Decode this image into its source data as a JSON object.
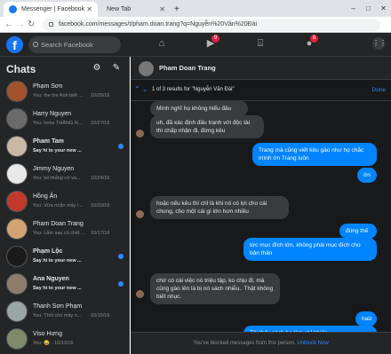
{
  "browser": {
    "tabs": [
      {
        "title": "Messenger | Facebook",
        "active": true
      },
      {
        "title": "New Tab",
        "active": false
      }
    ],
    "new_tab": "+",
    "url": "facebook.com/messages/t/pham.doan.trang?q=Nguyễn%20Văn%20Đài",
    "controls": {
      "minimize": "–",
      "maximize": "□",
      "close": "✕"
    }
  },
  "fb": {
    "logo": "f",
    "search_placeholder": "Search Facebook",
    "nav": [
      {
        "icon": "home-icon",
        "glyph": "⌂",
        "badge": ""
      },
      {
        "icon": "watch-icon",
        "glyph": "▶",
        "badge": "9"
      },
      {
        "icon": "marketplace-icon",
        "glyph": "⌸",
        "badge": ""
      },
      {
        "icon": "groups-icon",
        "glyph": "●",
        "badge": "6"
      }
    ],
    "menu_icon": "⋮⋮"
  },
  "sidebar": {
    "title": "Chats",
    "chats": [
      {
        "name": "Phạm Sơn",
        "preview": "You: ihe ihe  Anh biết ...",
        "time": "10/28/16",
        "unread": false,
        "color": "#a0522d"
      },
      {
        "name": "Harry Nguyen",
        "preview": "You: hehe THĂNG N...",
        "time": "10/27/16",
        "unread": false,
        "color": "#6b6b6b"
      },
      {
        "name": "Pham Tam",
        "preview": "Say hi to your new ...",
        "time": "",
        "unread": true,
        "color": "#c9b8a6"
      },
      {
        "name": "Jimmy Nguyen",
        "preview": "You: bỏ thắng cờ va...",
        "time": "10/24/16",
        "unread": false,
        "color": "#e8e8e8"
      },
      {
        "name": "Hồng Ân",
        "preview": "You: Vừa nhắn mấy l...",
        "time": "10/20/16",
        "unread": false,
        "color": "#c0392b"
      },
      {
        "name": "Pham Doan Trang",
        "preview": "You: Lắm sau có chết ...",
        "time": "10/17/16",
        "unread": false,
        "color": "#d4a373"
      },
      {
        "name": "Phạm Lộc",
        "preview": "Say hi to your new ...",
        "time": "",
        "unread": true,
        "color": "#1b1b1b"
      },
      {
        "name": "Ana Nguyen",
        "preview": "Say hi to your new ...",
        "time": "",
        "unread": true,
        "color": "#8e7d6b"
      },
      {
        "name": "Thanh Sơn Phạm",
        "preview": "You: Thôi cho máy n...",
        "time": "10/15/16",
        "unread": false,
        "color": "#9aa5a6"
      },
      {
        "name": "Viso Hưng",
        "preview": "You: 😂 · 10/13/16",
        "time": "",
        "unread": false,
        "color": "#7d8b6a"
      }
    ]
  },
  "conversation": {
    "name": "Pham Doan Trang",
    "find": {
      "result": "1 of 3 results for \"Nguyễn Văn Đài\"",
      "done": "Done",
      "arrows": "⌃⌄"
    },
    "messages": [
      {
        "dir": "in",
        "text": "Mình nghĩ họ không hiểu đâu"
      },
      {
        "dir": "in",
        "text": "uh, đã xác định đấu tranh với độc tài thì chấp nhận đi, đừng kêu"
      },
      {
        "dir": "out",
        "text": "Trang mà cũng viết kêu gào như họ chắc mình ớn Trang luôn"
      },
      {
        "dir": "out",
        "text": "ớn"
      },
      {
        "dir": "in",
        "text": "hoặc nếu kêu thì chỉ là khi nó có lợi cho cái chung, cho một cái gì lớn hơn nhiều"
      },
      {
        "dir": "out",
        "text": "đúng thế"
      },
      {
        "dir": "out",
        "text": "tức mục đích lớn, không phải mục đích cho bản thân"
      },
      {
        "dir": "in",
        "text": "chứ có cái việc nó triệu tập, ko chịu đi, mà cũng gào lên là bị nó sách nhiễu.. Thật không biết nhục."
      },
      {
        "dir": "out",
        "text": "haiz"
      },
      {
        "dir": "out",
        "text": "Tôi thấy cách họ làm chỉ khiến ..."
      }
    ],
    "blocked_text": "You've blocked messages from this person.",
    "unblock_label": "Unblock Now"
  }
}
